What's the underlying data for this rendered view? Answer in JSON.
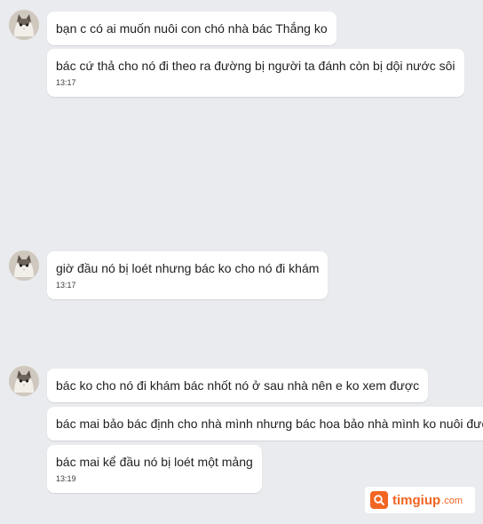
{
  "messages": [
    {
      "text": "bạn c có ai muốn nuôi con chó nhà bác Thắng ko",
      "time": ""
    },
    {
      "text": "bác cứ thả cho nó đi theo ra đường bị người ta đánh còn bị dội nước sôi",
      "time": "13:17"
    },
    {
      "text": "giờ đầu nó bị loét nhưng bác ko cho nó đi khám",
      "time": "13:17"
    },
    {
      "text": "bác ko cho nó đi khám bác nhốt nó ở sau nhà nên e ko xem được",
      "time": ""
    },
    {
      "text": "bác mai bảo bác định cho nhà mình nhưng bác hoa bảo nhà mình ko nuôi được",
      "time": ""
    },
    {
      "text": "bác mai kể đầu nó bị loét một mảng",
      "time": "13:19"
    }
  ],
  "watermark": {
    "name": "timgiup",
    "suffix": ".com",
    "brand_color": "#f26522"
  },
  "avatar_icon": "cat-avatar",
  "background_color": "#e9ebee"
}
